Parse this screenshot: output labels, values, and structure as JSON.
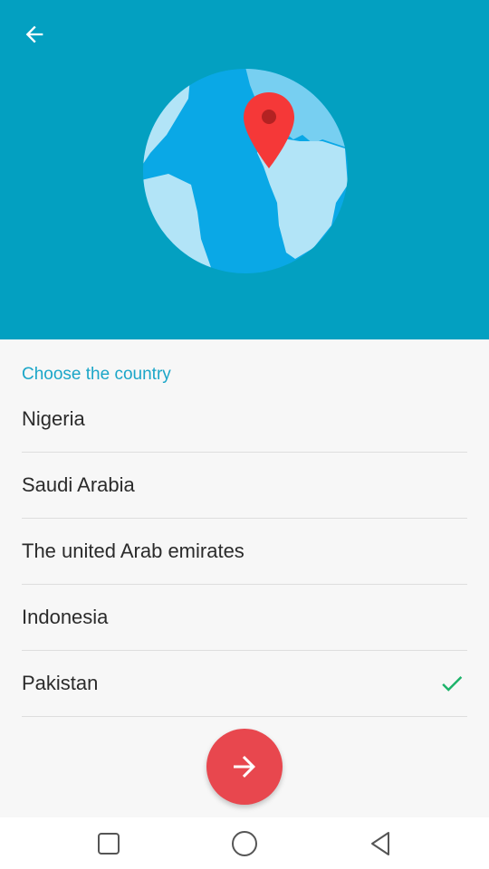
{
  "header": {
    "back_icon": "arrow-left-icon",
    "illustration": "globe-with-location-pin",
    "background_color": "#03a0c1"
  },
  "content": {
    "section_label": "Choose the country",
    "countries": [
      {
        "name": "Nigeria",
        "selected": false
      },
      {
        "name": "Saudi Arabia",
        "selected": false
      },
      {
        "name": "The united Arab emirates",
        "selected": false
      },
      {
        "name": "Indonesia",
        "selected": false
      },
      {
        "name": "Pakistan",
        "selected": true
      }
    ],
    "check_color": "#1db36a",
    "next_icon": "arrow-right-icon",
    "next_button_color": "#e8474e"
  },
  "navbar": {
    "recents_icon": "square-icon",
    "home_icon": "circle-icon",
    "back_icon": "triangle-back-icon"
  }
}
